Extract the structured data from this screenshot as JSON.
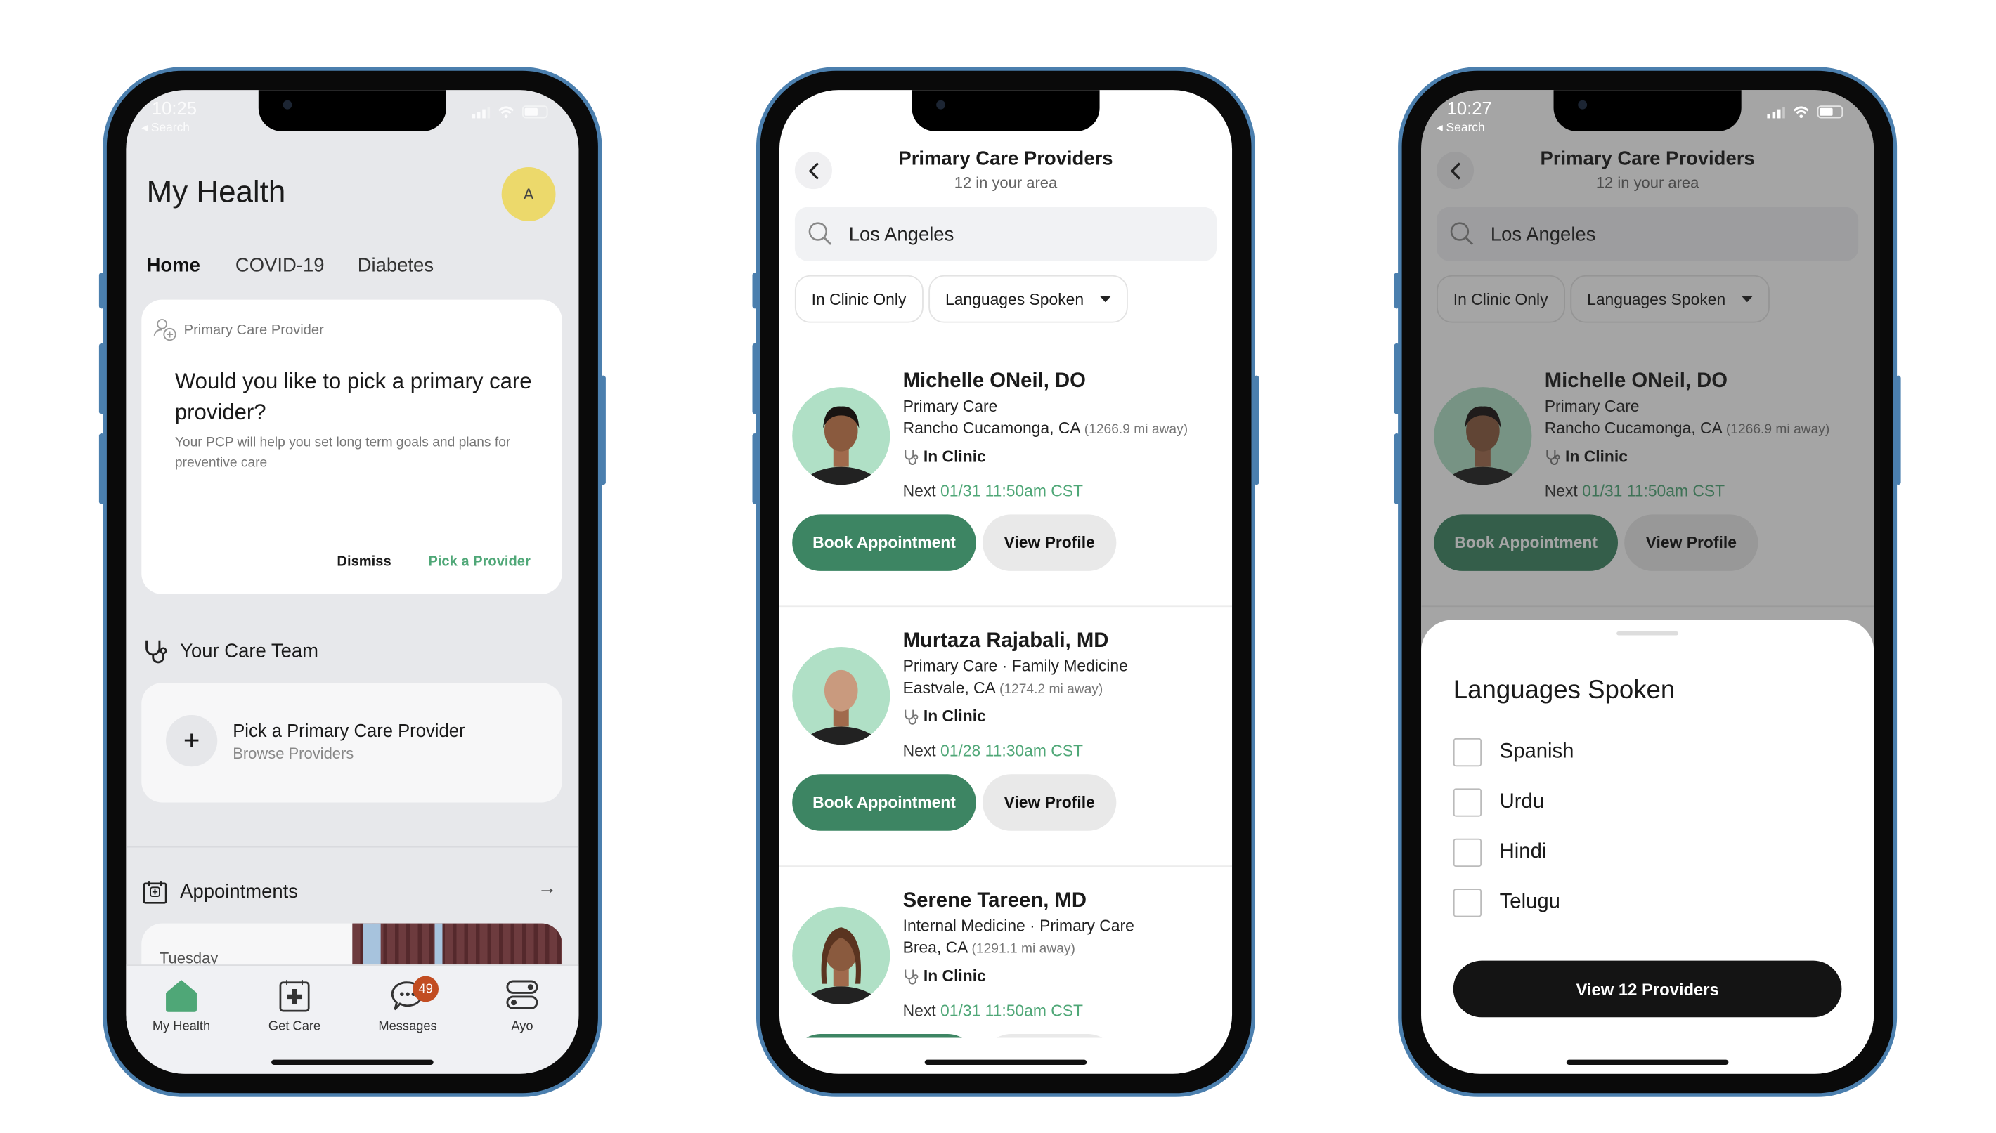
{
  "colors": {
    "brand_green": "#3d8563",
    "link_green": "#4fa777",
    "avatar_yellow": "#ecd96b",
    "badge_red": "#c24d22",
    "photo_bg": "#b0e0c6"
  },
  "phone1": {
    "status": {
      "time": "10:25",
      "back": "◂ Search"
    },
    "title": "My Health",
    "avatar_initial": "A",
    "tabs": [
      {
        "label": "Home",
        "active": true
      },
      {
        "label": "COVID-19"
      },
      {
        "label": "Diabetes"
      }
    ],
    "pcp_card": {
      "label": "Primary Care Provider",
      "question": "Would you like to pick a primary care provider?",
      "description": "Your PCP will help you set long term goals and plans for preventive care",
      "dismiss": "Dismiss",
      "pick": "Pick a Provider"
    },
    "care_team": {
      "title": "Your Care Team",
      "item_title": "Pick a Primary Care Provider",
      "item_subtitle": "Browse Providers"
    },
    "appointments": {
      "title": "Appointments",
      "day": "Tuesday"
    },
    "tabbar": [
      {
        "label": "My Health",
        "icon": "home-icon",
        "active": true
      },
      {
        "label": "Get Care",
        "icon": "medical-calendar-icon"
      },
      {
        "label": "Messages",
        "icon": "chat-icon",
        "badge": "49"
      },
      {
        "label": "Ayo",
        "icon": "toggles-icon"
      }
    ]
  },
  "providers_screen": {
    "title": "Primary Care Providers",
    "subtitle": "12 in your area",
    "search_value": "Los Angeles",
    "filters": {
      "in_clinic": "In Clinic Only",
      "languages": "Languages Spoken"
    },
    "next_label": "Next",
    "book_label": "Book Appointment",
    "view_label": "View Profile",
    "providers": [
      {
        "name": "Michelle ONeil, DO",
        "specialty": "Primary Care",
        "location": "Rancho Cucamonga, CA",
        "distance": "(1266.9 mi away)",
        "mode": "In Clinic",
        "next": "01/31 11:50am CST"
      },
      {
        "name": "Murtaza Rajabali, MD",
        "specialty": "Primary Care · Family Medicine",
        "location": "Eastvale, CA",
        "distance": "(1274.2 mi away)",
        "mode": "In Clinic",
        "next": "01/28 11:30am CST"
      },
      {
        "name": "Serene Tareen, MD",
        "specialty": "Internal Medicine · Primary Care",
        "location": "Brea, CA",
        "distance": "(1291.1 mi away)",
        "mode": "In Clinic",
        "next": "01/31 11:50am CST"
      }
    ]
  },
  "phone3": {
    "status": {
      "time": "10:27",
      "back": "◂ Search"
    },
    "sheet": {
      "title": "Languages Spoken",
      "options": [
        {
          "label": "Spanish",
          "checked": false
        },
        {
          "label": "Urdu",
          "checked": false
        },
        {
          "label": "Hindi",
          "checked": false
        },
        {
          "label": "Telugu",
          "checked": false
        }
      ],
      "cta": "View 12 Providers"
    }
  }
}
